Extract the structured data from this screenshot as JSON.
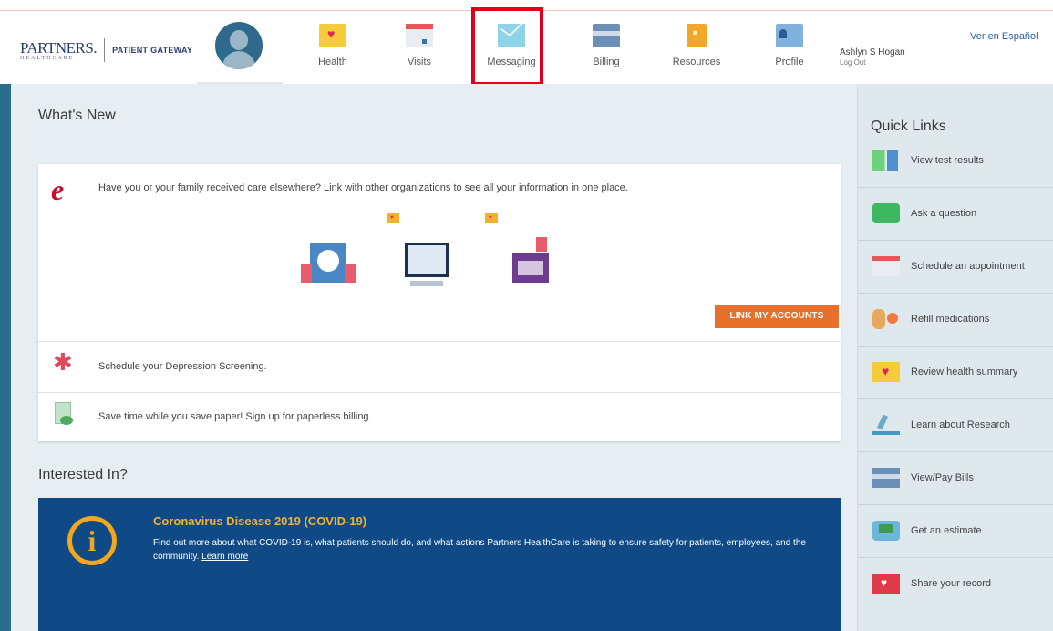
{
  "header": {
    "logo_name": "PARTNERS.",
    "logo_sub": "HEALTHCARE",
    "logo_product": "PATIENT GATEWAY",
    "nav": [
      {
        "label": "Health",
        "icon": "health-heart-icon"
      },
      {
        "label": "Visits",
        "icon": "calendar-icon"
      },
      {
        "label": "Messaging",
        "icon": "envelope-icon"
      },
      {
        "label": "Billing",
        "icon": "credit-card-icon"
      },
      {
        "label": "Resources",
        "icon": "book-icon"
      },
      {
        "label": "Profile",
        "icon": "id-card-icon"
      }
    ],
    "user_name": "Ashlyn S Hogan",
    "logout_label": "Log Out",
    "language_link": "Ver en Español"
  },
  "main": {
    "whats_new_title": "What's New",
    "link_accounts": {
      "text": "Have you or your family received care elsewhere? Link with other organizations to see all your information in one place.",
      "button_label": "LINK MY ACCOUNTS"
    },
    "rows": [
      {
        "text": "Schedule your Depression Screening.",
        "icon": "medical-star-icon"
      },
      {
        "text": "Save time while you save paper! Sign up for paperless billing.",
        "icon": "paperless-bill-icon"
      }
    ],
    "interested_title": "Interested In?",
    "covid": {
      "title": "Coronavirus Disease 2019 (COVID-19)",
      "body": "Find out more about what COVID-19 is, what patients should do, and what actions Partners HealthCare is taking to ensure safety for patients, employees, and the community.",
      "link": "Learn more"
    }
  },
  "quick_links": {
    "title": "Quick Links",
    "items": [
      {
        "label": "View test results",
        "icon": "test-results-icon"
      },
      {
        "label": "Ask a question",
        "icon": "chat-bubble-icon"
      },
      {
        "label": "Schedule an appointment",
        "icon": "calendar-icon"
      },
      {
        "label": "Refill medications",
        "icon": "pill-icon"
      },
      {
        "label": "Review health summary",
        "icon": "health-heart-icon"
      },
      {
        "label": "Learn about Research",
        "icon": "microscope-icon"
      },
      {
        "label": "View/Pay Bills",
        "icon": "credit-card-icon"
      },
      {
        "label": "Get an estimate",
        "icon": "estimate-icon"
      },
      {
        "label": "Share your record",
        "icon": "share-record-icon"
      }
    ]
  },
  "colors": {
    "accent_orange": "#e8702a",
    "brand_navy": "#0f4a87",
    "highlight_red": "#e0001a"
  }
}
